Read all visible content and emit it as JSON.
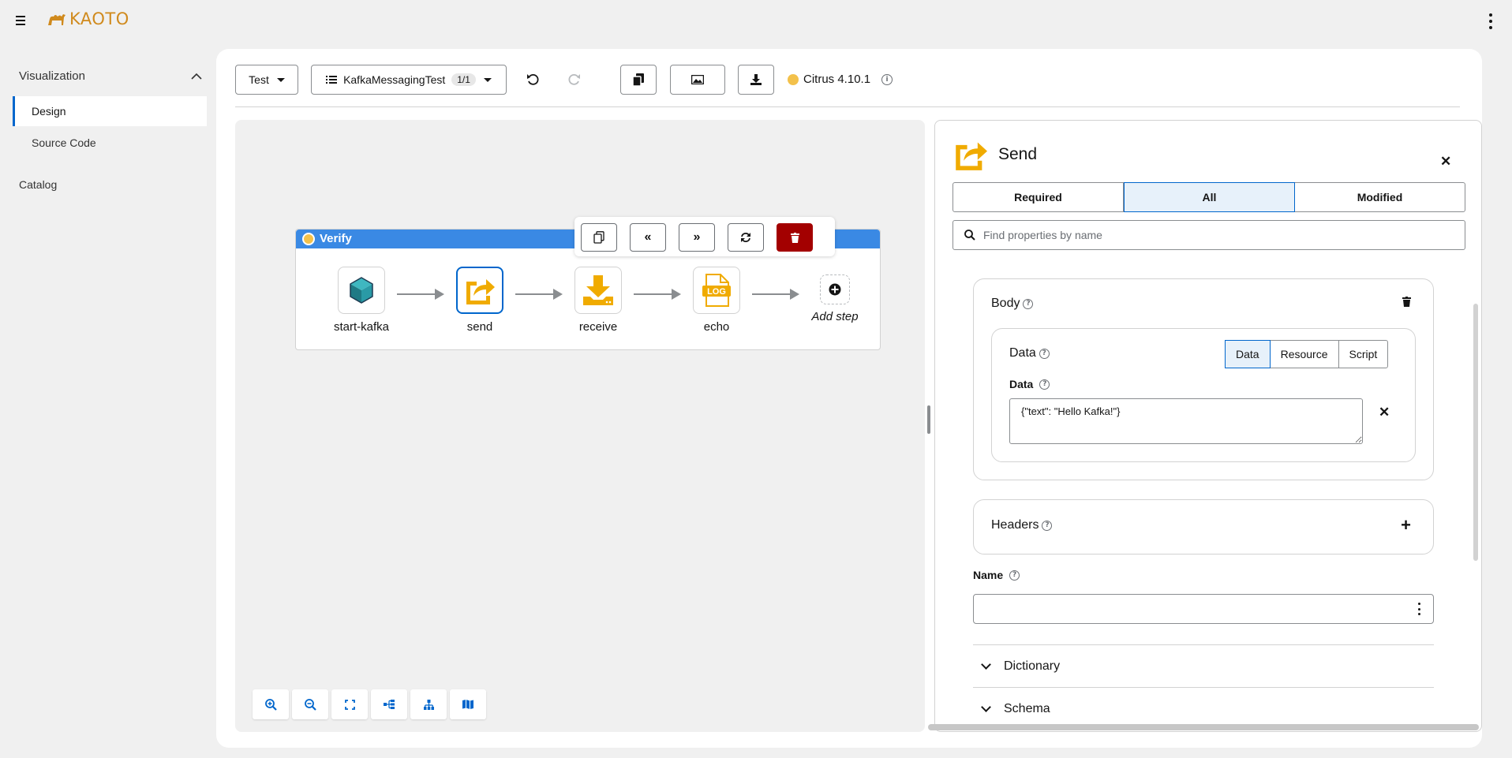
{
  "app": {
    "logo_text": "KAOTO"
  },
  "sidebar": {
    "group_label": "Visualization",
    "items": [
      {
        "label": "Design",
        "active": true
      },
      {
        "label": "Source Code",
        "active": false
      }
    ],
    "catalog_label": "Catalog"
  },
  "toolbar": {
    "type_select": "Test",
    "flow_select": "KafkaMessagingTest",
    "flow_count": "1/1",
    "runtime": "Citrus 4.10.1"
  },
  "canvas": {
    "route_title": "Verify",
    "steps": [
      {
        "label": "start-kafka",
        "icon": "kafka-cube-icon"
      },
      {
        "label": "send",
        "icon": "send-share-icon",
        "selected": true
      },
      {
        "label": "receive",
        "icon": "receive-download-icon"
      },
      {
        "label": "echo",
        "icon": "log-icon"
      }
    ],
    "add_step_label": "Add step",
    "node_toolbar_icons": [
      "copy-icon",
      "prepend-icon",
      "append-icon",
      "replace-icon",
      "delete-icon"
    ],
    "zoom_controls": [
      "zoom-in-icon",
      "zoom-out-icon",
      "fit-view-icon",
      "horizontal-layout-icon",
      "vertical-layout-icon",
      "legend-icon"
    ]
  },
  "panel": {
    "title": "Send",
    "tabs": [
      {
        "label": "Required",
        "active": false
      },
      {
        "label": "All",
        "active": true
      },
      {
        "label": "Modified",
        "active": false
      }
    ],
    "search_placeholder": "Find properties by name",
    "body": {
      "title": "Body",
      "data_section_title": "Data",
      "toggles": [
        {
          "label": "Data",
          "active": true
        },
        {
          "label": "Resource",
          "active": false
        },
        {
          "label": "Script",
          "active": false
        }
      ],
      "data_field_label": "Data",
      "data_value": "{\"text\": \"Hello Kafka!\"}"
    },
    "headers_title": "Headers",
    "name_label": "Name",
    "name_value": "",
    "sections": [
      "Dictionary",
      "Schema"
    ]
  },
  "colors": {
    "accent": "#0066cc",
    "route_header": "#3a89e4",
    "icon_orange": "#f0ab00",
    "danger": "#a30000",
    "logo": "#d08a1d"
  }
}
